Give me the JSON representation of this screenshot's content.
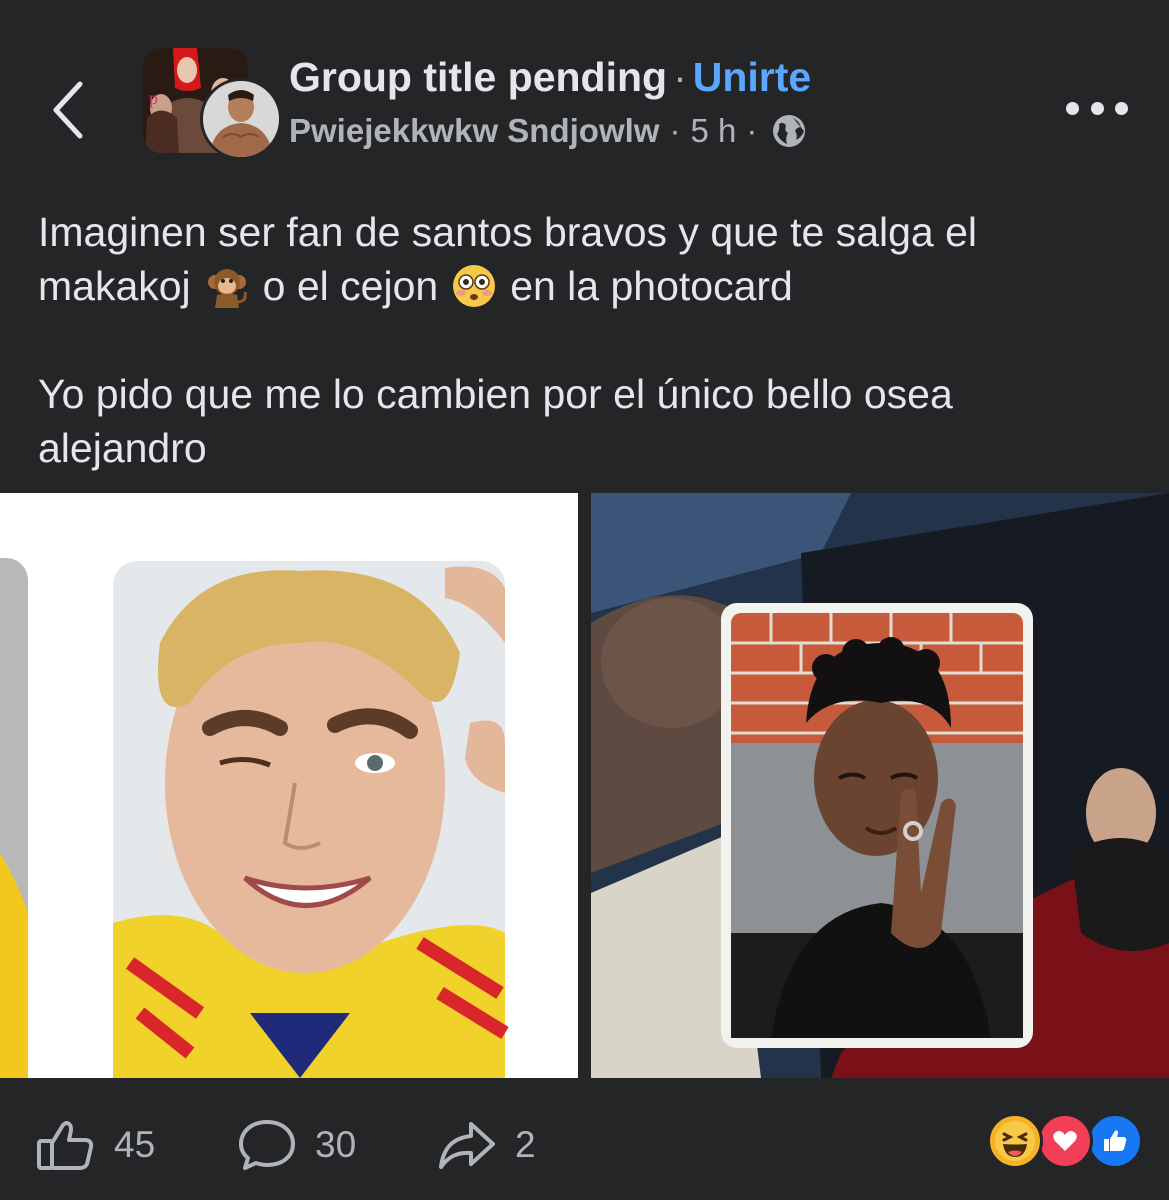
{
  "header": {
    "group_title": "Group title pending",
    "separator": "·",
    "join_label": "Unirte",
    "author": "Pwiejekkwkw Sndjowlw",
    "time": "5 h",
    "icons": {
      "back": "chevron-left-icon",
      "audience": "globe-icon",
      "more": "more-options-icon"
    }
  },
  "post": {
    "line1": "Imaginen ser fan de santos bravos y que te salga el",
    "line2a": "makakoj",
    "line2b": "o el cejon",
    "line2c": "en la photocard",
    "line3": "Yo pido que me lo cambien por el único bello osea",
    "line4": "alejandro",
    "emojis": [
      "monkey-emoji",
      "flushed-face-emoji"
    ]
  },
  "photos": [
    {
      "name": "photocard-blond-man-winking",
      "background": "#ffffff"
    },
    {
      "name": "photocard-curly-hair-peace-sign",
      "background": "#1e2a3a"
    }
  ],
  "actions": {
    "likes": "45",
    "comments": "30",
    "shares": "2"
  },
  "reactions": [
    "haha-reaction-icon",
    "love-reaction-icon",
    "like-reaction-icon"
  ],
  "colors": {
    "background": "#242526",
    "text": "#e4e6eb",
    "secondary": "#b0b3b8",
    "link": "#5aa7ff",
    "love": "#f33e58",
    "like": "#1877f2",
    "haha": "#f7b125"
  }
}
